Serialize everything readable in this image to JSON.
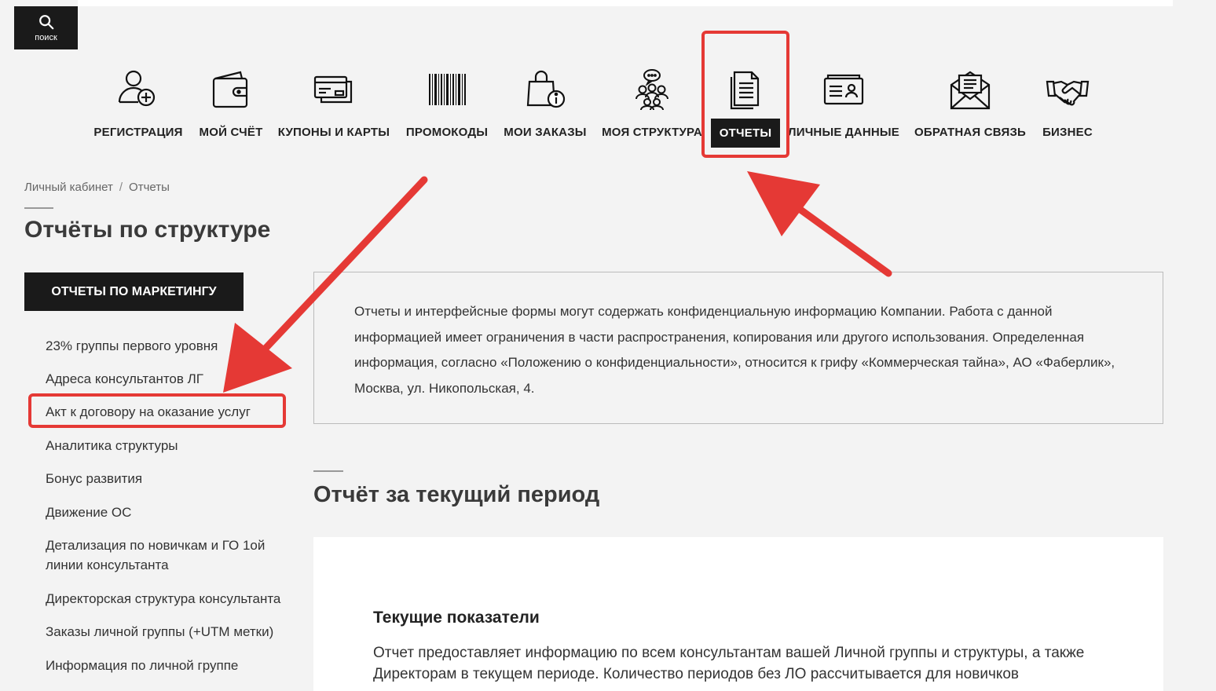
{
  "search": {
    "label": "поиск"
  },
  "nav": {
    "items": [
      {
        "label": "РЕГИСТРАЦИЯ",
        "icon": "user-plus-icon"
      },
      {
        "label": "МОЙ СЧЁТ",
        "icon": "wallet-icon"
      },
      {
        "label": "КУПОНЫ И КАРТЫ",
        "icon": "cards-icon"
      },
      {
        "label": "ПРОМОКОДЫ",
        "icon": "barcode-icon"
      },
      {
        "label": "МОИ ЗАКАЗЫ",
        "icon": "shopping-bag-info-icon"
      },
      {
        "label": "МОЯ СТРУКТУРА",
        "icon": "team-icon"
      },
      {
        "label": "ОТЧЕТЫ",
        "icon": "documents-icon"
      },
      {
        "label": "ЛИЧНЫЕ ДАННЫЕ",
        "icon": "id-card-icon"
      },
      {
        "label": "ОБРАТНАЯ СВЯЗЬ",
        "icon": "envelope-icon"
      },
      {
        "label": "БИЗНЕС",
        "icon": "handshake-icon"
      }
    ]
  },
  "breadcrumb": {
    "home": "Личный кабинет",
    "separator": "/",
    "current": "Отчеты"
  },
  "page_title": "Отчёты по структуре",
  "sidebar": {
    "button_label": "ОТЧЕТЫ ПО МАРКЕТИНГУ",
    "items": [
      "23% группы первого уровня",
      "Адреса консультантов ЛГ",
      "Акт к договору на оказание услуг",
      "Аналитика структуры",
      "Бонус развития",
      "Движение ОС",
      "Детализация по новичкам и ГО 1ой линии консультанта",
      "Директорская структура консультанта",
      "Заказы личной группы (+UTM метки)",
      "Информация по личной группе"
    ]
  },
  "notice": {
    "text": "Отчеты и интерфейсные формы могут содержать конфиденциальную информацию Компании. Работа с данной информацией имеет ограничения в части распространения, копирования или другого использования. Определенная информация, согласно «Положению о конфиденциальности», относится к грифу «Коммерческая тайна», АО «Фаберлик», Москва, ул. Никопольская, 4."
  },
  "current_period": {
    "title": "Отчёт за текущий период",
    "card_title": "Текущие показатели",
    "card_text": "Отчет предоставляет информацию по всем консультантам вашей Личной группы и структуры, а также Директорам в текущем периоде. Количество периодов без ЛО рассчитывается для новичков"
  },
  "colors": {
    "dark": "#1a1a1a",
    "annotation_red": "#e53935",
    "background": "#f3f3f3"
  }
}
